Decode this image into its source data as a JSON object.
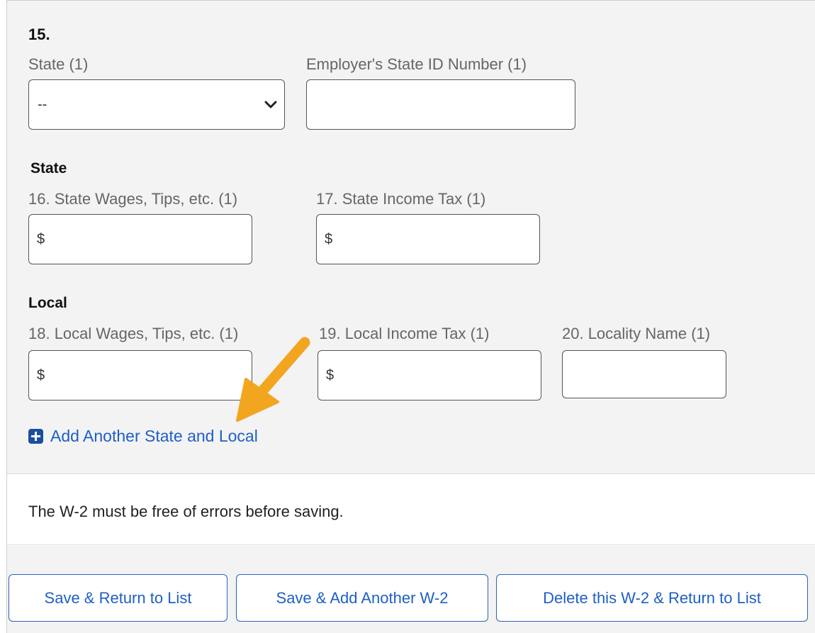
{
  "section15": {
    "number": "15.",
    "state_label": "State (1)",
    "state_selected": "--",
    "employer_id_label": "Employer's State ID Number (1)",
    "employer_id_value": ""
  },
  "state_section": {
    "heading": "State",
    "wages_label": "16. State Wages, Tips, etc. (1)",
    "wages_prefix": "$",
    "tax_label": "17. State Income Tax (1)",
    "tax_prefix": "$"
  },
  "local_section": {
    "heading": "Local",
    "wages_label": "18. Local Wages, Tips, etc. (1)",
    "wages_prefix": "$",
    "tax_label": "19. Local Income Tax (1)",
    "tax_prefix": "$",
    "locality_label": "20. Locality Name (1)",
    "locality_value": ""
  },
  "add_link": {
    "icon": "plus-square-icon",
    "label": "Add Another State and Local"
  },
  "message": "The W-2 must be free of errors before saving.",
  "buttons": {
    "save_return": "Save & Return to List",
    "save_add": "Save & Add Another W-2",
    "delete_return": "Delete this W-2 & Return to List"
  },
  "colors": {
    "link_blue": "#1e5fc6",
    "annotation_arrow": "#f2a51f",
    "panel_gray": "#f3f3f3"
  }
}
